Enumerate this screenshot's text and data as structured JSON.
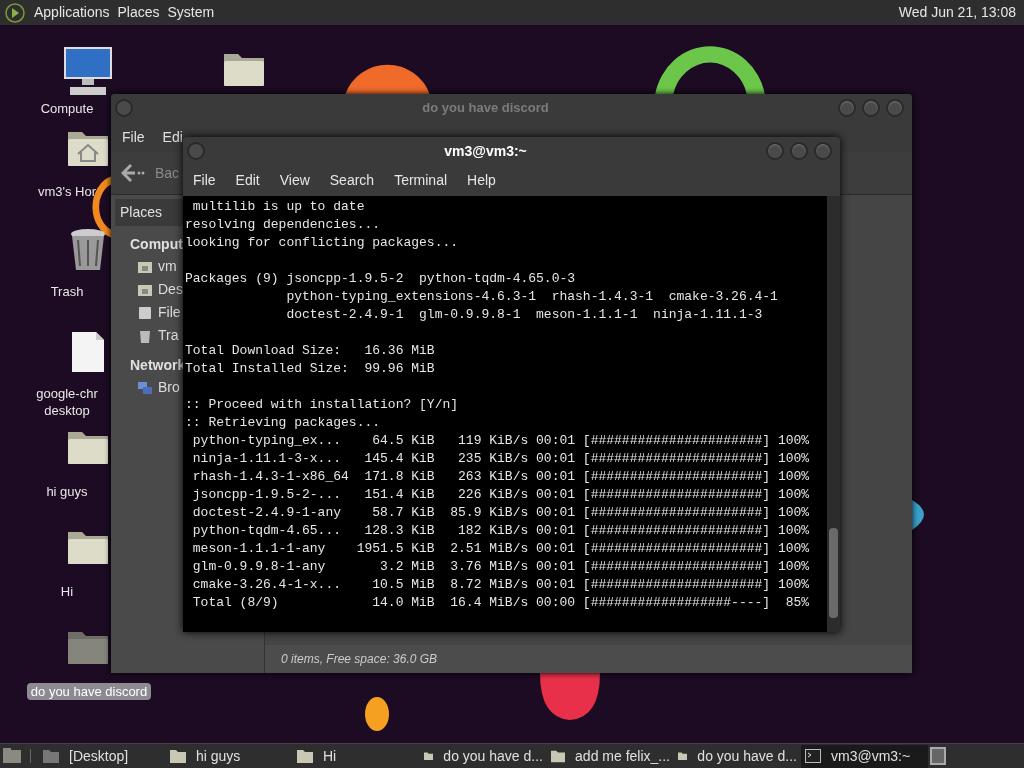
{
  "top_panel": {
    "menus": [
      "Applications",
      "Places",
      "System"
    ],
    "clock": "Wed Jun 21, 13:08"
  },
  "desktop_icons": [
    {
      "kind": "computer",
      "label_lines": [
        "Compute"
      ],
      "selected": false
    },
    {
      "kind": "folder",
      "selected": false
    },
    {
      "kind": "home",
      "label_lines": [
        "vm3's Hor"
      ],
      "selected": false
    },
    {
      "kind": "trash",
      "label_lines": [
        "Trash"
      ],
      "selected": false
    },
    {
      "kind": "document",
      "label_lines": [
        "google-chr",
        "desktop"
      ],
      "selected": false
    },
    {
      "kind": "folder",
      "label_lines": [
        "hi guys"
      ],
      "selected": false
    },
    {
      "kind": "folder",
      "label_lines": [
        "Hi"
      ],
      "selected": false
    },
    {
      "kind": "folder",
      "label_lines": [
        "do you have discord"
      ],
      "selected": true
    }
  ],
  "file_manager": {
    "title": "do you have discord",
    "active": false,
    "menu": [
      "File",
      "Edi"
    ],
    "back": "Bac",
    "sidebar": {
      "header": "Places",
      "sections": [
        {
          "title": "Comput",
          "items": [
            {
              "kind": "home",
              "label": "vm"
            },
            {
              "kind": "desktop",
              "label": "Des"
            },
            {
              "kind": "drive",
              "label": "File"
            },
            {
              "kind": "trash",
              "label": "Tra"
            }
          ]
        },
        {
          "title": "Network",
          "items": [
            {
              "kind": "network",
              "label": "Bro"
            }
          ]
        }
      ]
    },
    "status": "0 items, Free space: 36.0 GB"
  },
  "terminal": {
    "title": "vm3@vm3:~",
    "active": true,
    "menu": [
      "File",
      "Edit",
      "View",
      "Search",
      "Terminal",
      "Help"
    ],
    "blocks": [
      [
        " multilib is up to date",
        "resolving dependencies...",
        "looking for conflicting packages..."
      ],
      [
        "Packages (9) jsoncpp-1.9.5-2  python-tqdm-4.65.0-3",
        "             python-typing_extensions-4.6.3-1  rhash-1.4.3-1  cmake-3.26.4-1",
        "             doctest-2.4.9-1  glm-0.9.9.8-1  meson-1.1.1-1  ninja-1.11.1-3"
      ],
      [
        "Total Download Size:   16.36 MiB",
        "Total Installed Size:  99.96 MiB"
      ],
      [
        ":: Proceed with installation? [Y/n]",
        ":: Retrieving packages...",
        " python-typing_ex...    64.5 KiB   119 KiB/s 00:01 [######################] 100%",
        " ninja-1.11.1-3-x...   145.4 KiB   235 KiB/s 00:01 [######################] 100%",
        " rhash-1.4.3-1-x86_64  171.8 KiB   263 KiB/s 00:01 [######################] 100%",
        " jsoncpp-1.9.5-2-...   151.4 KiB   226 KiB/s 00:01 [######################] 100%",
        " doctest-2.4.9-1-any    58.7 KiB  85.9 KiB/s 00:01 [######################] 100%",
        " python-tqdm-4.65...   128.3 KiB   182 KiB/s 00:01 [######################] 100%",
        " meson-1.1.1-1-any    1951.5 KiB  2.51 MiB/s 00:01 [######################] 100%",
        " glm-0.9.9.8-1-any       3.2 MiB  3.76 MiB/s 00:01 [######################] 100%",
        " cmake-3.26.4-1-x...    10.5 MiB  8.72 MiB/s 00:01 [######################] 100%",
        " Total (8/9)            14.0 MiB  16.4 MiB/s 00:00 [##################----]  85%"
      ]
    ]
  },
  "taskbar": {
    "items": [
      {
        "kind": "desktop",
        "label": "[Desktop]",
        "selected": false
      },
      {
        "kind": "folder",
        "label": "hi guys",
        "selected": false
      },
      {
        "kind": "folder",
        "label": "Hi",
        "selected": false
      },
      {
        "kind": "folder",
        "label": "do you have d...",
        "selected": false
      },
      {
        "kind": "folder",
        "label": "add me felix_...",
        "selected": false
      },
      {
        "kind": "folder",
        "label": "do you have d...",
        "selected": false
      },
      {
        "kind": "terminal",
        "label": "vm3@vm3:~",
        "selected": true
      }
    ]
  }
}
